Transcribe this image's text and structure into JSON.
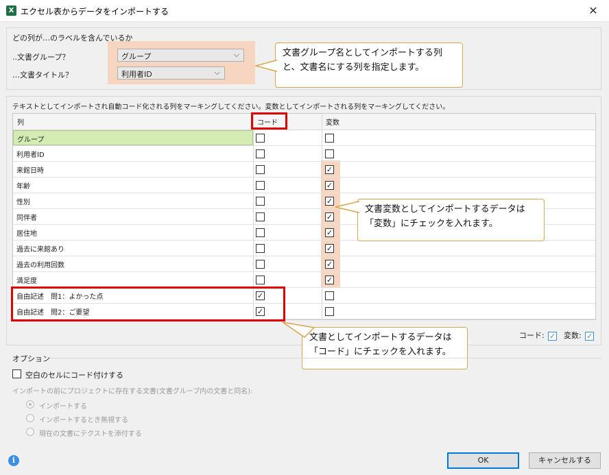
{
  "window": {
    "title": "エクセル表からデータをインポートする",
    "app_icon": "X",
    "close": "✕"
  },
  "labels_panel": {
    "title": "どの列が…のラベルを含んでいるか",
    "doc_group_label": "..文書グループ？",
    "doc_group_value": "グループ",
    "doc_title_label": "…文書タイトル？",
    "doc_title_value": "利用者ID"
  },
  "callouts": {
    "top": "文書グループ名としてインポートする列と、文書名にする列を指定します。",
    "variable": "文書変数としてインポートするデータは「変数」にチェックを入れます。",
    "code": "文書としてインポートするデータは「コード」にチェックを入れます。"
  },
  "columns_panel": {
    "instruction": "テキストとしてインポートされ自動コード化される列をマーキングしてください。変数としてインポートされる列をマーキングしてください。",
    "headers": {
      "col": "列",
      "code": "コード",
      "variable": "変数"
    },
    "rows": [
      {
        "name": "グループ",
        "code": false,
        "variable": false
      },
      {
        "name": "利用者ID",
        "code": false,
        "variable": false
      },
      {
        "name": "来館日時",
        "code": false,
        "variable": true
      },
      {
        "name": "年齢",
        "code": false,
        "variable": true
      },
      {
        "name": "性別",
        "code": false,
        "variable": true
      },
      {
        "name": "同伴者",
        "code": false,
        "variable": true
      },
      {
        "name": "居住地",
        "code": false,
        "variable": true
      },
      {
        "name": "過去に来館あり",
        "code": false,
        "variable": true
      },
      {
        "name": "過去の利用回数",
        "code": false,
        "variable": true
      },
      {
        "name": "満足度",
        "code": false,
        "variable": true
      },
      {
        "name": "自由記述　問1：よかった点",
        "code": true,
        "variable": false
      },
      {
        "name": "自由記述　問2：ご要望",
        "code": true,
        "variable": false
      }
    ],
    "legend_code": "コード:",
    "legend_variable": "変数:"
  },
  "options": {
    "title": "オプション",
    "code_empty_cells": "空白のセルにコード付けする",
    "existing_doc_label": "インポートの前にプロジェクトに存在する文書(文書グループ内の文書と同名):",
    "radio_import": "インポートする",
    "radio_ignore": "インポートするとき無視する",
    "radio_append": "現在の文書にテクストを添付する"
  },
  "buttons": {
    "ok": "OK",
    "cancel": "キャンセルする"
  },
  "colors": {
    "highlight": "#f6d6c0",
    "callout_border": "#d9a44a",
    "red_box": "#e00000",
    "accent": "#0078d7"
  }
}
